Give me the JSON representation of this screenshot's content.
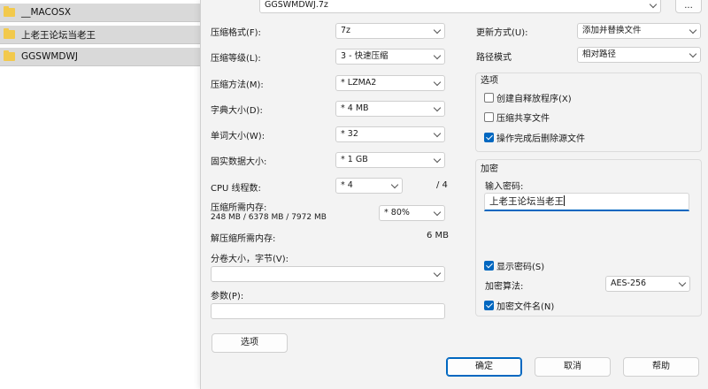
{
  "explorer": {
    "items": [
      {
        "name": "__MACOSX"
      },
      {
        "name": "上老王论坛当老王"
      },
      {
        "name": "GGSWMDWJ"
      }
    ]
  },
  "dialog": {
    "archive_path": "GGSWMDWJ.7z",
    "browse_label": "...",
    "format_label": "压缩格式(F):",
    "format_value": "7z",
    "level_label": "压缩等级(L):",
    "level_value": "3 - 快速压缩",
    "method_label": "压缩方法(M):",
    "method_value": "* LZMA2",
    "dict_label": "字典大小(D):",
    "dict_value": "* 4 MB",
    "word_label": "单词大小(W):",
    "word_value": "* 32",
    "solid_label": "固实数据大小:",
    "solid_value": "* 1 GB",
    "cpu_label": "CPU 线程数:",
    "cpu_value": "* 4",
    "cpu_total": "/ 4",
    "mem_comp_label": "压缩所需内存:",
    "mem_comp_detail": "248 MB / 6378 MB / 7972 MB",
    "mem_comp_value": "* 80%",
    "mem_decomp_label": "解压缩所需内存:",
    "mem_decomp_value": "6 MB",
    "split_label": "分卷大小，字节(V):",
    "split_value": "",
    "params_label": "参数(P):",
    "params_value": "",
    "options_button": "选项",
    "update_label": "更新方式(U):",
    "update_value": "添加并替换文件",
    "path_label": "路径模式",
    "path_value": "相对路径",
    "options_group": {
      "title": "选项",
      "sfx": "创建自释放程序(X)",
      "shared": "压缩共享文件",
      "delete": "操作完成后删除源文件"
    },
    "encrypt_group": {
      "title": "加密",
      "password_label": "输入密码:",
      "password_value": "上老王论坛当老王",
      "show_password": "显示密码(S)",
      "method_label": "加密算法:",
      "method_value": "AES-256",
      "encrypt_names": "加密文件名(N)"
    },
    "ok": "确定",
    "cancel": "取消",
    "help": "帮助"
  }
}
